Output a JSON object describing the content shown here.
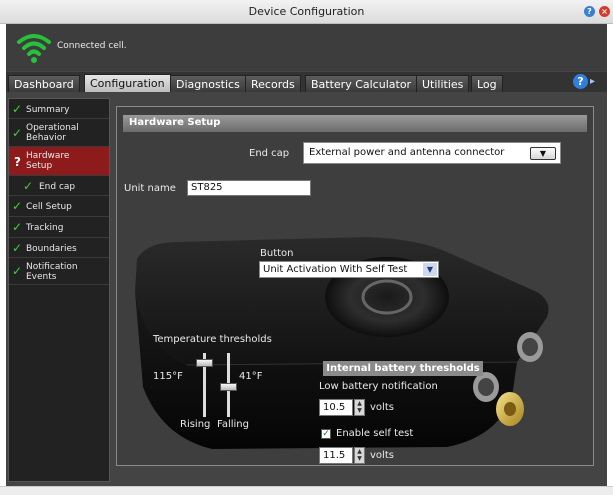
{
  "window": {
    "title": "Device Configuration",
    "help_icon": "?",
    "close_icon": "×"
  },
  "status": {
    "text": "Connected cell."
  },
  "tabs": [
    {
      "label": "Dashboard"
    },
    {
      "label": "Configuration"
    },
    {
      "label": "Diagnostics"
    },
    {
      "label": "Records"
    },
    {
      "label": "Battery Calculator"
    },
    {
      "label": "Utilities"
    },
    {
      "label": "Log"
    }
  ],
  "help": {
    "label": "?"
  },
  "sidebar": {
    "items": [
      {
        "label": "Summary",
        "mark": "✓"
      },
      {
        "label": "Operational Behavior",
        "mark": "✓"
      },
      {
        "label": "Hardware Setup",
        "mark": "?"
      },
      {
        "label": "End cap",
        "mark": "✓"
      },
      {
        "label": "Cell Setup",
        "mark": "✓"
      },
      {
        "label": "Tracking",
        "mark": "✓"
      },
      {
        "label": "Boundaries",
        "mark": "✓"
      },
      {
        "label": "Notification Events",
        "mark": "✓"
      }
    ]
  },
  "hardware": {
    "header": "Hardware Setup",
    "end_cap_label": "End cap",
    "end_cap_value": "External power and antenna connector",
    "unit_name_label": "Unit name",
    "unit_name_value": "ST825",
    "button_label": "Button",
    "button_value": "Unit Activation With Self Test",
    "temp_label": "Temperature thresholds",
    "temp_high": "115°F",
    "temp_low": "41°F",
    "rising_label": "Rising",
    "falling_label": "Falling",
    "battery_header": "Internal battery thresholds",
    "low_batt_label": "Low battery notification",
    "low_batt_value": "10.5",
    "volts1": "volts",
    "self_test_label": "Enable self test",
    "self_test_checked": true,
    "self_test_value": "11.5",
    "volts2": "volts"
  },
  "colors": {
    "accent_red": "#8e1b1b",
    "check_green": "#3bd23b",
    "help_blue": "#2f7fe0"
  }
}
